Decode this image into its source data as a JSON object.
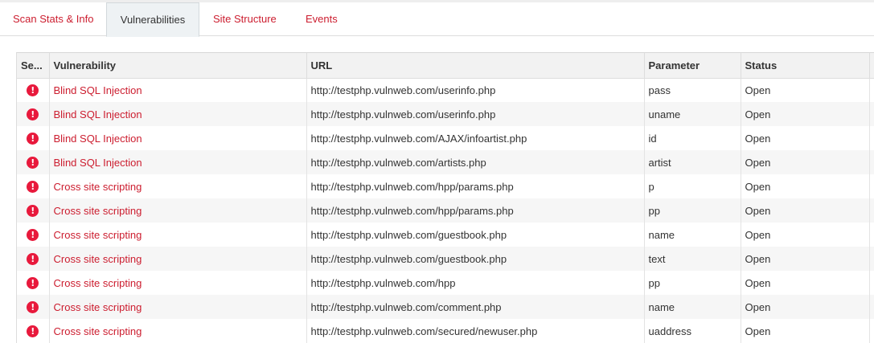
{
  "tabs": [
    {
      "label": "Scan Stats & Info",
      "active": false
    },
    {
      "label": "Vulnerabilities",
      "active": true
    },
    {
      "label": "Site Structure",
      "active": false
    },
    {
      "label": "Events",
      "active": false
    }
  ],
  "table": {
    "headers": {
      "severity": "Se...",
      "vulnerability": "Vulnerability",
      "url": "URL",
      "parameter": "Parameter",
      "status": "Status"
    },
    "rows": [
      {
        "severity_icon": "!",
        "vulnerability": "Blind SQL Injection",
        "url": "http://testphp.vulnweb.com/userinfo.php",
        "parameter": "pass",
        "status": "Open"
      },
      {
        "severity_icon": "!",
        "vulnerability": "Blind SQL Injection",
        "url": "http://testphp.vulnweb.com/userinfo.php",
        "parameter": "uname",
        "status": "Open"
      },
      {
        "severity_icon": "!",
        "vulnerability": "Blind SQL Injection",
        "url": "http://testphp.vulnweb.com/AJAX/infoartist.php",
        "parameter": "id",
        "status": "Open"
      },
      {
        "severity_icon": "!",
        "vulnerability": "Blind SQL Injection",
        "url": "http://testphp.vulnweb.com/artists.php",
        "parameter": "artist",
        "status": "Open"
      },
      {
        "severity_icon": "!",
        "vulnerability": "Cross site scripting",
        "url": "http://testphp.vulnweb.com/hpp/params.php",
        "parameter": "p",
        "status": "Open"
      },
      {
        "severity_icon": "!",
        "vulnerability": "Cross site scripting",
        "url": "http://testphp.vulnweb.com/hpp/params.php",
        "parameter": "pp",
        "status": "Open"
      },
      {
        "severity_icon": "!",
        "vulnerability": "Cross site scripting",
        "url": "http://testphp.vulnweb.com/guestbook.php",
        "parameter": "name",
        "status": "Open"
      },
      {
        "severity_icon": "!",
        "vulnerability": "Cross site scripting",
        "url": "http://testphp.vulnweb.com/guestbook.php",
        "parameter": "text",
        "status": "Open"
      },
      {
        "severity_icon": "!",
        "vulnerability": "Cross site scripting",
        "url": "http://testphp.vulnweb.com/hpp",
        "parameter": "pp",
        "status": "Open"
      },
      {
        "severity_icon": "!",
        "vulnerability": "Cross site scripting",
        "url": "http://testphp.vulnweb.com/comment.php",
        "parameter": "name",
        "status": "Open"
      },
      {
        "severity_icon": "!",
        "vulnerability": "Cross site scripting",
        "url": "http://testphp.vulnweb.com/secured/newuser.php",
        "parameter": "uaddress",
        "status": "Open"
      }
    ]
  },
  "colors": {
    "accent_red": "#cc1d2f",
    "severity_high": "#e8193c",
    "header_bg": "#f2f2f2",
    "active_tab_bg": "#eef2f4"
  },
  "icons": {
    "severity": "exclamation-circle-icon"
  }
}
